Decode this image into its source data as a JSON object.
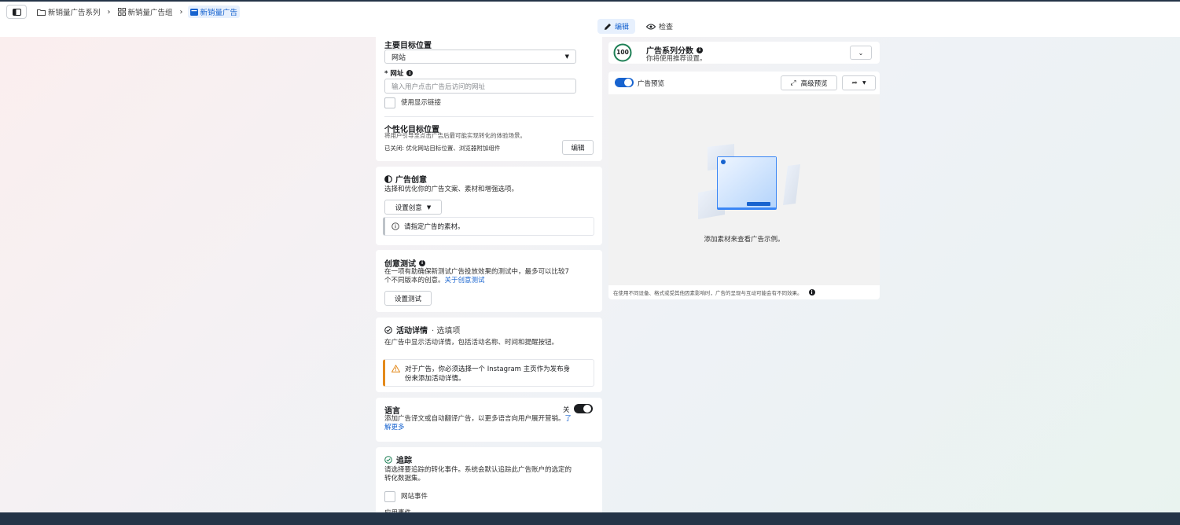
{
  "breadcrumb": {
    "campaign": "新销量广告系列",
    "adset": "新销量广告组",
    "ad": "新销量广告"
  },
  "mode_tabs": {
    "edit": "编辑",
    "review": "检查"
  },
  "destination": {
    "title": "主要目标位置",
    "select_value": "网站",
    "url_label": "* 网址",
    "url_placeholder": "输入用户点击广告后访问的网址",
    "display_link_label": "使用显示链接",
    "personal_title": "个性化目标位置",
    "personal_desc": "将用户引导至点击广告后最可能实现转化的体验场景。",
    "personal_status": "已关闭: 优化网站目标位置、浏览器附加组件",
    "edit_button": "编辑"
  },
  "creative": {
    "title": "广告创意",
    "desc": "选择和优化你的广告文案、素材和增强选项。",
    "setup_button": "设置创意",
    "notice": "请指定广告的素材。"
  },
  "creative_test": {
    "title": "创意测试",
    "desc_line1": "在一项有助确保新测试广告投放效果的测试中，最多可以比较7",
    "desc_line2": "个不同版本的创意。",
    "link": "关于创意测试",
    "setup_button": "设置测试"
  },
  "activity": {
    "title": "活动详情",
    "title_suffix": " · 选填项",
    "desc": "在广告中显示活动详情，包括活动名称、时间和提醒按钮。",
    "warning_line1": "对于广告，你必须选择一个 Instagram 主页作为发布身",
    "warning_line2": "份来添加活动详情。"
  },
  "language": {
    "title": "语言",
    "toggle_label": "关",
    "desc_line1": "添加广告译文或自动翻译广告，以更多语言向用户展开营销。",
    "link_part1": "了",
    "link_part2": "解更多"
  },
  "tracking": {
    "title": "追踪",
    "desc_line1": "请选择要追踪的转化事件。系统会默认追踪此广告账户的选定的",
    "desc_line2": "转化数据集。",
    "website_events": "网站事件",
    "app_events": "应用事件"
  },
  "score": {
    "value": "100",
    "title": "广告系列分数",
    "desc": "你将使用推荐设置。"
  },
  "preview": {
    "toggle_label": "广告预览",
    "advanced_button": "高级预览",
    "empty_text": "添加素材来查看广告示例。",
    "footer_note": "在使用不同设备、格式或受其他因素影响时，广告的呈现与互动可能会有不同效果。"
  },
  "colors": {
    "primary": "#1763cf",
    "score_ring": "#1d7f55",
    "warning": "#e48a1b",
    "toggle_on": "#1763cf",
    "toggle_off": "#1c1e21",
    "header_dark": "#243447"
  }
}
